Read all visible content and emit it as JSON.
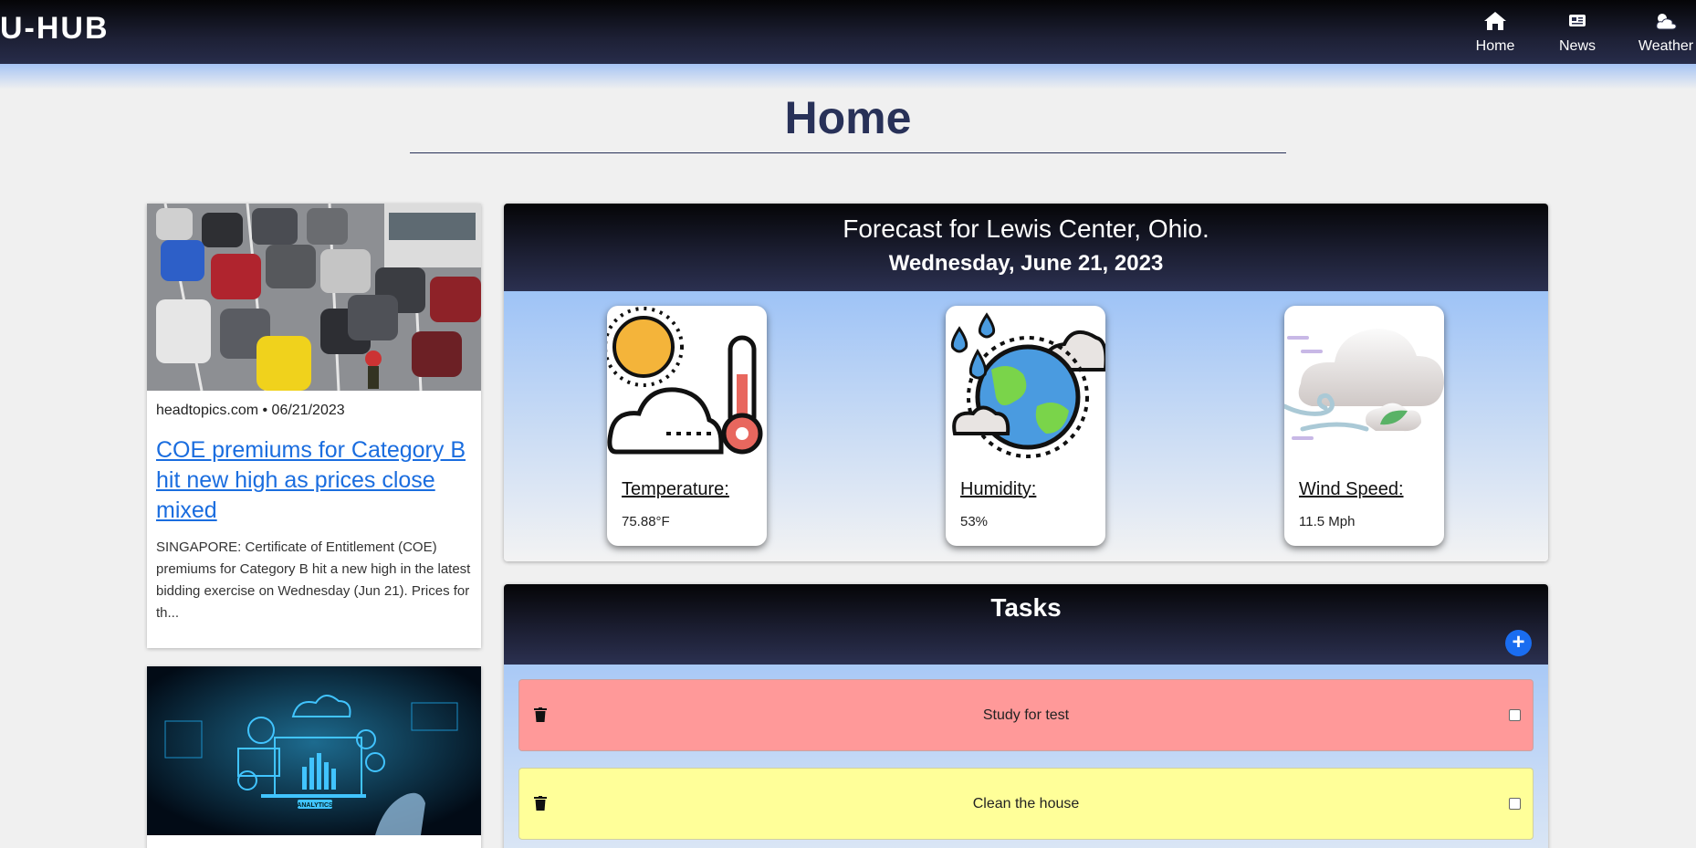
{
  "nav": {
    "brand": "U-HUB",
    "items": [
      {
        "label": "Home",
        "icon": "home-icon"
      },
      {
        "label": "News",
        "icon": "newspaper-icon"
      },
      {
        "label": "Weather",
        "icon": "cloud-sun-icon"
      }
    ]
  },
  "page": {
    "title": "Home"
  },
  "news": [
    {
      "source_date": "headtopics.com • 06/21/2023",
      "title": "COE premiums for Category B hit new high as prices close mixed",
      "description": "SINGAPORE: Certificate of Entitlement (COE) premiums for Category B hit a new high in the latest bidding exercise on Wednesday (Jun 21). Prices for th..."
    },
    {
      "image_text": "ANALYTICS"
    }
  ],
  "weather": {
    "title": "Forecast for Lewis Center, Ohio.",
    "date": "Wednesday, June 21, 2023",
    "cards": [
      {
        "label": "Temperature:",
        "value": "75.88°F",
        "icon": "temperature-icon"
      },
      {
        "label": "Humidity:",
        "value": "53%",
        "icon": "humidity-icon"
      },
      {
        "label": "Wind Speed:",
        "value": "11.5 Mph",
        "icon": "wind-icon"
      }
    ]
  },
  "tasks": {
    "title": "Tasks",
    "add_label": "+",
    "items": [
      {
        "text": "Study for test",
        "color": "#ff9999"
      },
      {
        "text": "Clean the house",
        "color": "#ffff99"
      }
    ]
  }
}
